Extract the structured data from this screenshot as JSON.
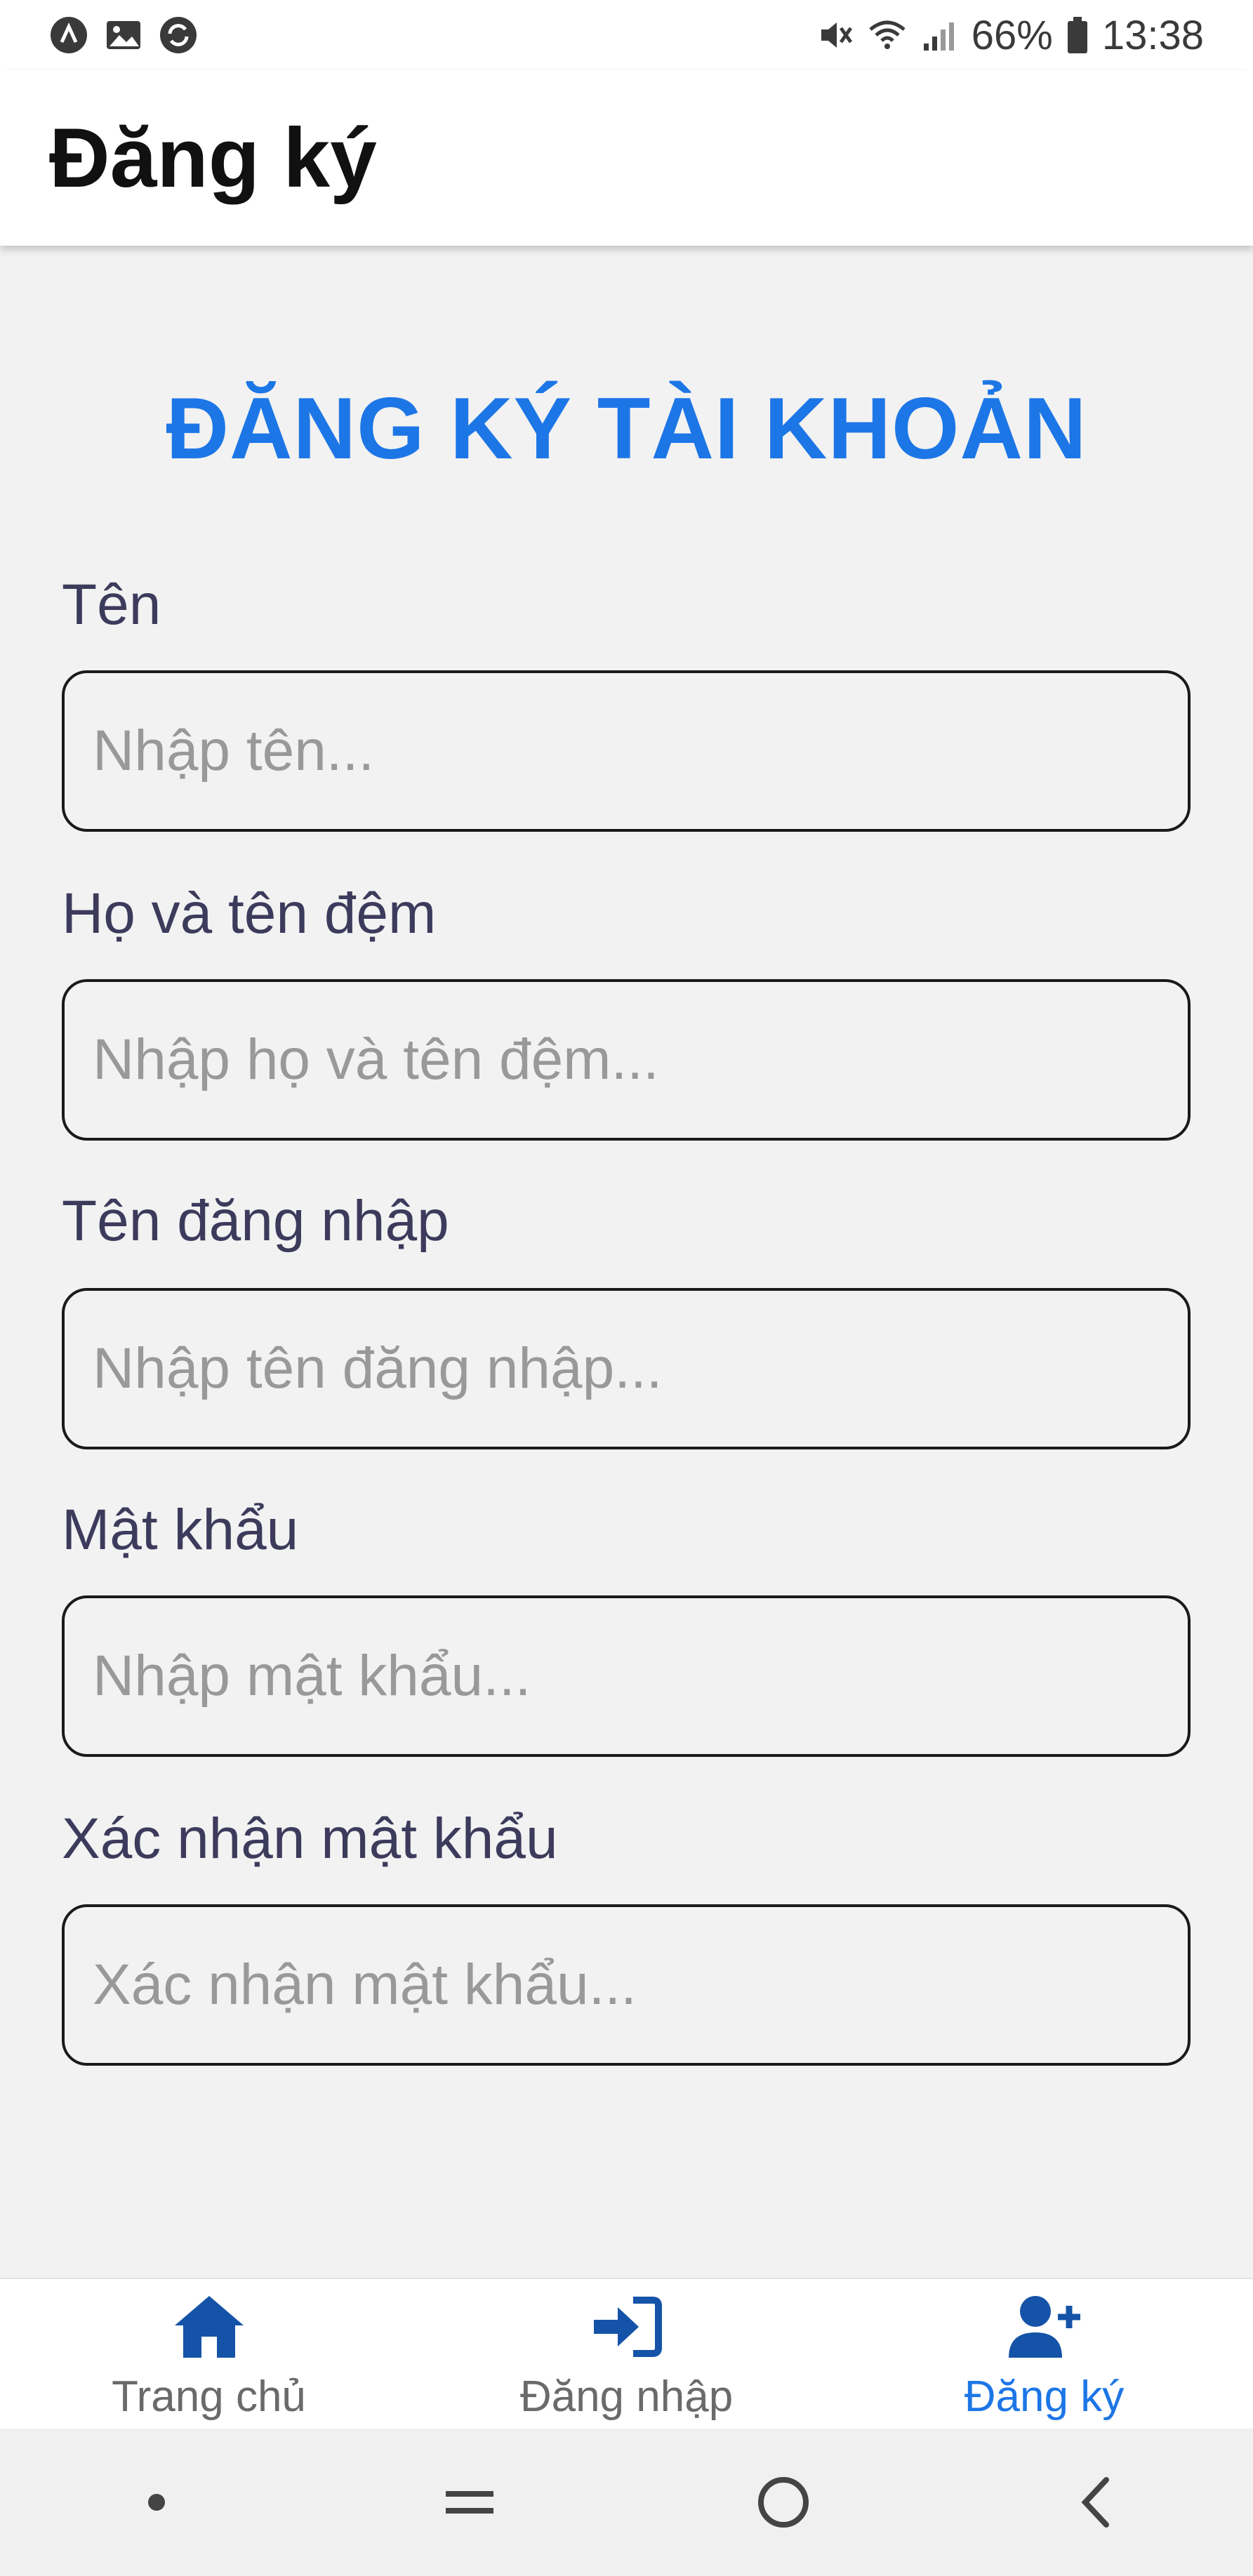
{
  "status_bar": {
    "battery": "66%",
    "time": "13:38",
    "left_icons": [
      "a-badge-icon",
      "image-icon",
      "sync-icon"
    ],
    "right_icons": [
      "mute-icon",
      "wifi-icon",
      "signal-icon",
      "battery-icon"
    ]
  },
  "app_bar": {
    "title": "Đăng ký"
  },
  "heading": "ĐĂNG KÝ TÀI KHOẢN",
  "form": {
    "fields": [
      {
        "label": "Tên",
        "placeholder": "Nhập tên...",
        "value": ""
      },
      {
        "label": "Họ và tên đệm",
        "placeholder": "Nhập họ và tên đệm...",
        "value": ""
      },
      {
        "label": "Tên đăng nhập",
        "placeholder": "Nhập tên đăng nhập...",
        "value": ""
      },
      {
        "label": "Mật khẩu",
        "placeholder": "Nhập mật khẩu...",
        "value": ""
      },
      {
        "label": "Xác nhận mật khẩu",
        "placeholder": "Xác nhận mật khẩu...",
        "value": ""
      }
    ]
  },
  "tab_bar": {
    "active_color": "#1d76e6",
    "icon_color": "#1553a8",
    "tabs": [
      {
        "label": "Trang chủ",
        "icon": "home-icon",
        "active": false
      },
      {
        "label": "Đăng nhập",
        "icon": "sign-in-icon",
        "active": false
      },
      {
        "label": "Đăng ký",
        "icon": "user-plus-icon",
        "active": true
      }
    ]
  },
  "system_nav": {
    "buttons": [
      "dot-icon",
      "recents-icon",
      "home-circle-icon",
      "back-icon"
    ]
  }
}
